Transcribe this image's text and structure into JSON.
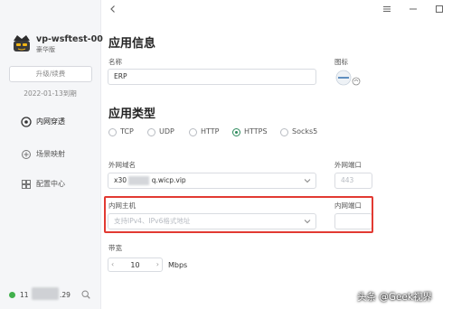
{
  "sidebar": {
    "device_name": "vp-wsftest-00",
    "edition": "豪华版",
    "upgrade_label": "升级/续费",
    "expiry": "2022-01-13到期",
    "nav": [
      {
        "label": "内网穿透",
        "icon": "lan-icon",
        "active": true
      },
      {
        "label": "场景映射",
        "icon": "scene-icon",
        "active": false
      },
      {
        "label": "配置中心",
        "icon": "settings-icon",
        "active": false
      }
    ],
    "ip_prefix": "11",
    "ip_suffix": ".29"
  },
  "window": {
    "back_icon": "chevron-left-icon",
    "menu_icon": "hamburger-icon",
    "minimize_icon": "minimize-icon",
    "maximize_icon": "maximize-icon"
  },
  "app_info": {
    "title": "应用信息",
    "name_label": "名称",
    "name_value": "ERP",
    "icon_label": "图标"
  },
  "app_type": {
    "title": "应用类型",
    "options": [
      "TCP",
      "UDP",
      "HTTP",
      "HTTPS",
      "Socks5"
    ],
    "selected": "HTTPS"
  },
  "external": {
    "domain_label": "外网域名",
    "domain_prefix": "x30",
    "domain_suffix": "q.wicp.vip",
    "port_label": "外网端口",
    "port_placeholder": "443"
  },
  "internal": {
    "host_label": "内网主机",
    "host_placeholder": "支持IPv4、IPv6格式地址",
    "port_label": "内网端口",
    "port_value": ""
  },
  "bandwidth": {
    "label": "带宽",
    "value": "10",
    "unit": "Mbps"
  },
  "watermark": "头条 @Geek视界",
  "colors": {
    "accent": "#2c8a5c",
    "highlight": "#e23a32",
    "sidebar_bg": "#f5f6f8"
  }
}
